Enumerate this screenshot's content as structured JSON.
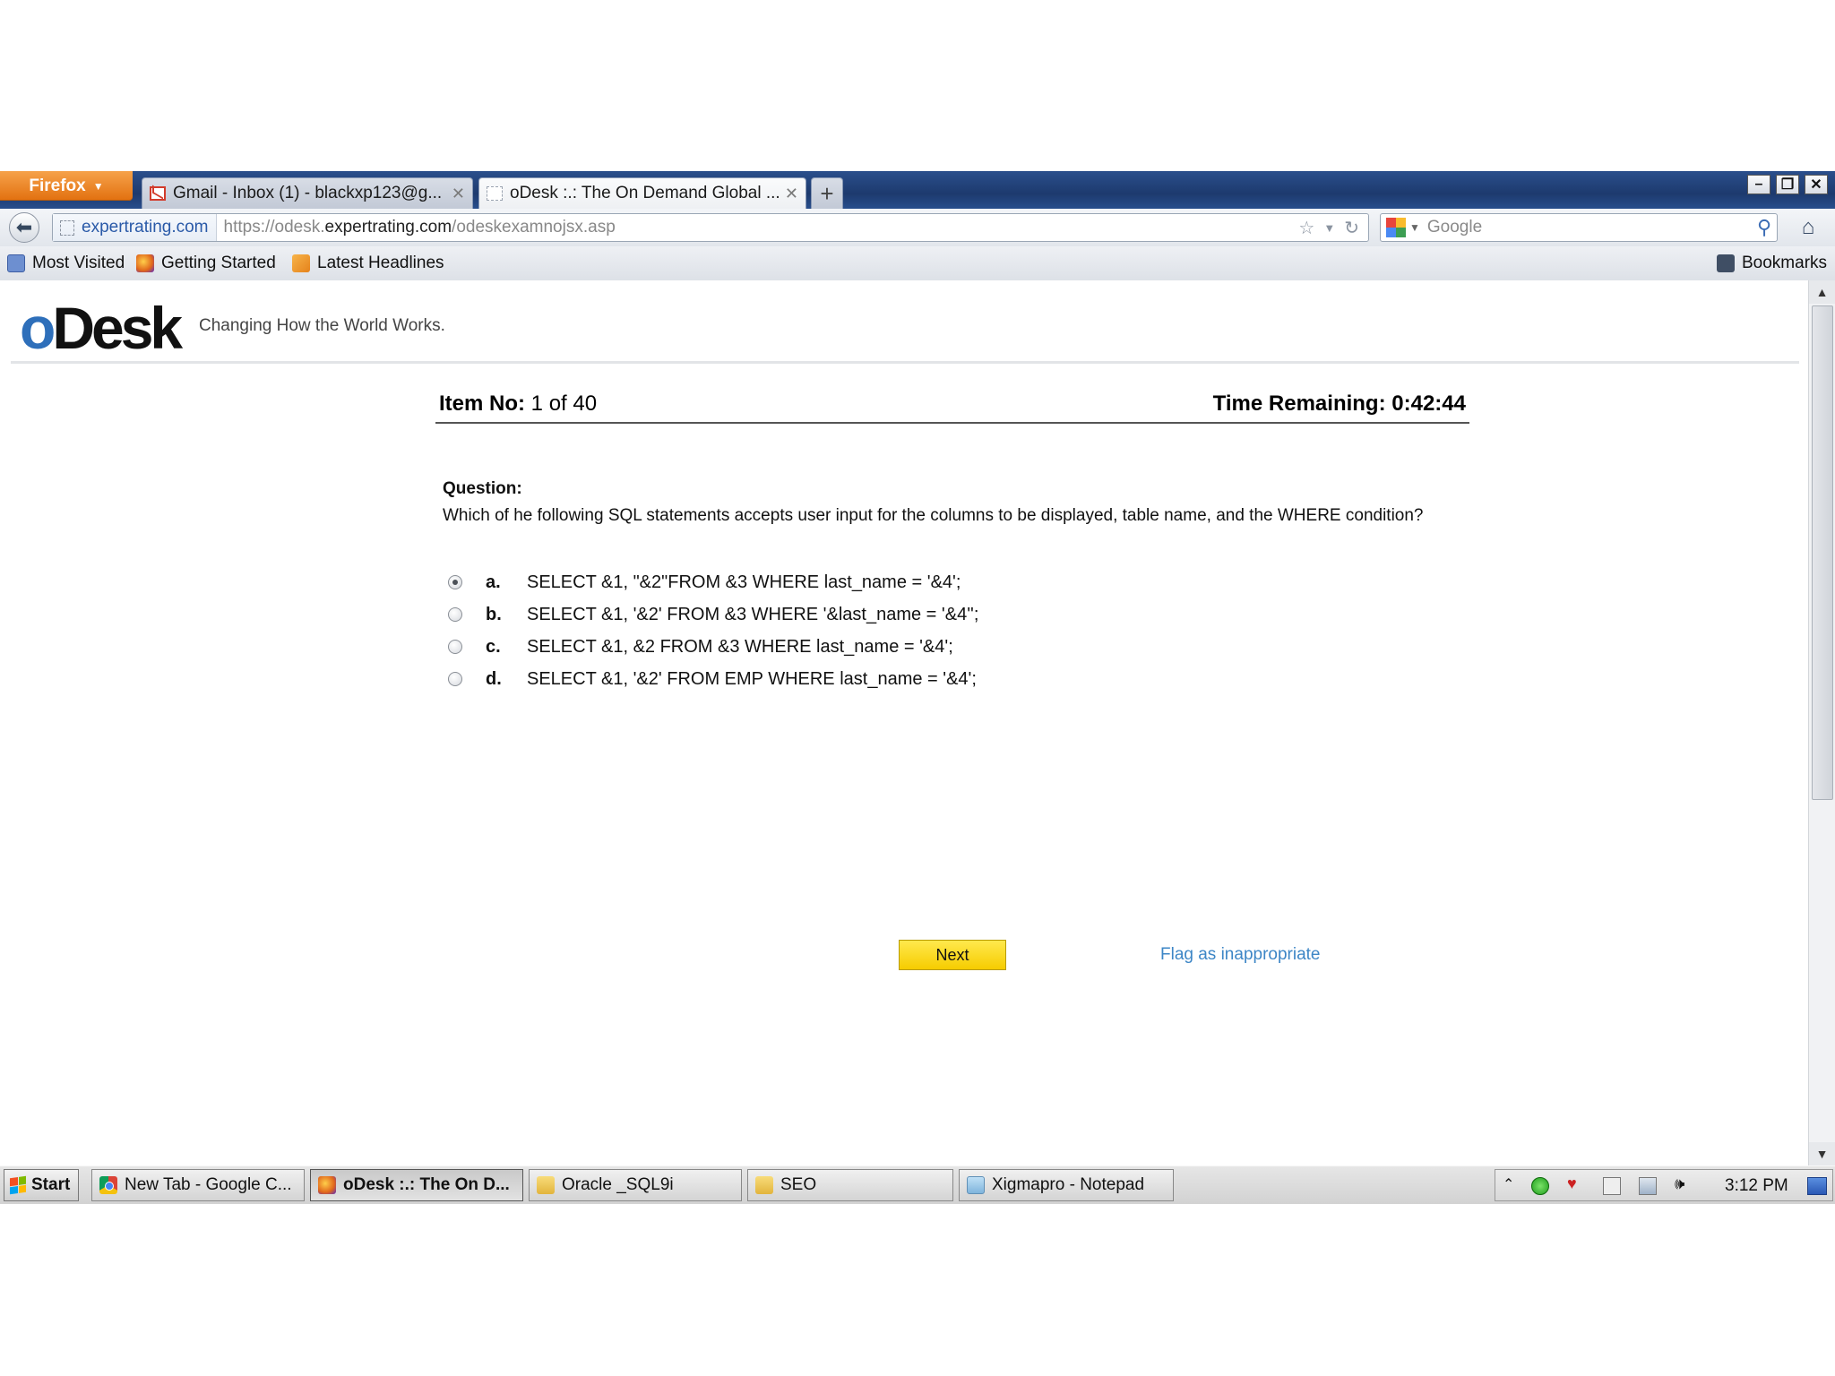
{
  "browser": {
    "app_button": "Firefox",
    "tabs": [
      {
        "title": "Gmail - Inbox (1) - blackxp123@g...",
        "icon": "gmail-icon"
      },
      {
        "title": "oDesk :.: The On Demand Global ...",
        "icon": "blank-page-icon"
      }
    ],
    "new_tab": "+",
    "url_identity": "expertrating.com",
    "url_prefix": "https://odesk.",
    "url_domain": "expertrating.com",
    "url_path": "/odeskexamnojsx.asp",
    "search_placeholder": "Google",
    "bookmarks": [
      "Most Visited",
      "Getting Started",
      "Latest Headlines"
    ],
    "bookmarks_menu": "Bookmarks"
  },
  "page": {
    "brand_o": "o",
    "brand_rest": "Desk",
    "tagline": "Changing How the World Works.",
    "item_label": "Item No:",
    "item_value": "1 of 40",
    "time_label": "Time Remaining:",
    "time_value": "0:42:44",
    "question_label": "Question:",
    "question_text": "Which of he following SQL statements accepts user input for the columns to be displayed, table name, and the WHERE condition?",
    "options": [
      {
        "letter": "a.",
        "text": "SELECT &1, \"&2\"FROM &3 WHERE last_name = '&4';",
        "selected": true
      },
      {
        "letter": "b.",
        "text": "SELECT &1, '&2' FROM &3 WHERE '&last_name = '&4'';",
        "selected": false
      },
      {
        "letter": "c.",
        "text": "SELECT &1, &2 FROM &3 WHERE last_name = '&4';",
        "selected": false
      },
      {
        "letter": "d.",
        "text": "SELECT &1, '&2' FROM EMP WHERE last_name = '&4';",
        "selected": false
      }
    ],
    "next_label": "Next",
    "flag_label": "Flag as inappropriate",
    "accent_color": "#f6cc00",
    "link_color": "#3d86c6"
  },
  "taskbar": {
    "start_label": "Start",
    "items": [
      {
        "label": "New Tab - Google C...",
        "icon": "chrome-icon",
        "active": false
      },
      {
        "label": "oDesk :.: The On D...",
        "icon": "firefox-icon",
        "active": true
      },
      {
        "label": "Oracle _SQL9i",
        "icon": "folder-icon",
        "active": false
      },
      {
        "label": "SEO",
        "icon": "folder-icon",
        "active": false
      },
      {
        "label": "Xigmapro - Notepad",
        "icon": "notepad-icon",
        "active": false
      }
    ],
    "clock": "3:12 PM"
  }
}
